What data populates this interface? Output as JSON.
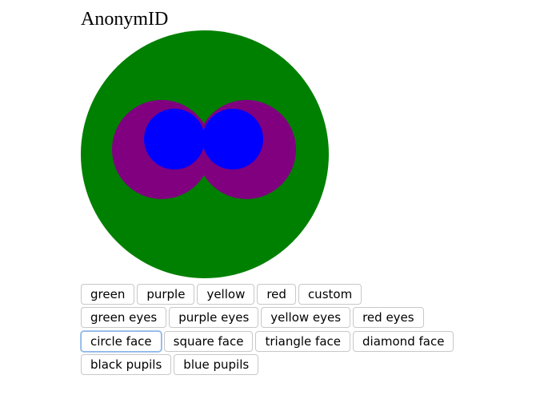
{
  "app": {
    "title": "AnonymID"
  },
  "avatar": {
    "face_shape": "circle",
    "face_color": "#008000",
    "eye_color": "#800080",
    "pupil_color": "#0000ff"
  },
  "controls": {
    "face_color_buttons": [
      {
        "label": "green"
      },
      {
        "label": "purple"
      },
      {
        "label": "yellow"
      },
      {
        "label": "red"
      },
      {
        "label": "custom"
      }
    ],
    "eye_color_buttons": [
      {
        "label": "green eyes"
      },
      {
        "label": "purple eyes"
      },
      {
        "label": "yellow eyes"
      },
      {
        "label": "red eyes"
      }
    ],
    "face_shape_buttons": [
      {
        "label": "circle face",
        "focused": true
      },
      {
        "label": "square face"
      },
      {
        "label": "triangle face"
      },
      {
        "label": "diamond face"
      }
    ],
    "pupil_buttons": [
      {
        "label": "black pupils"
      },
      {
        "label": "blue pupils"
      }
    ]
  }
}
